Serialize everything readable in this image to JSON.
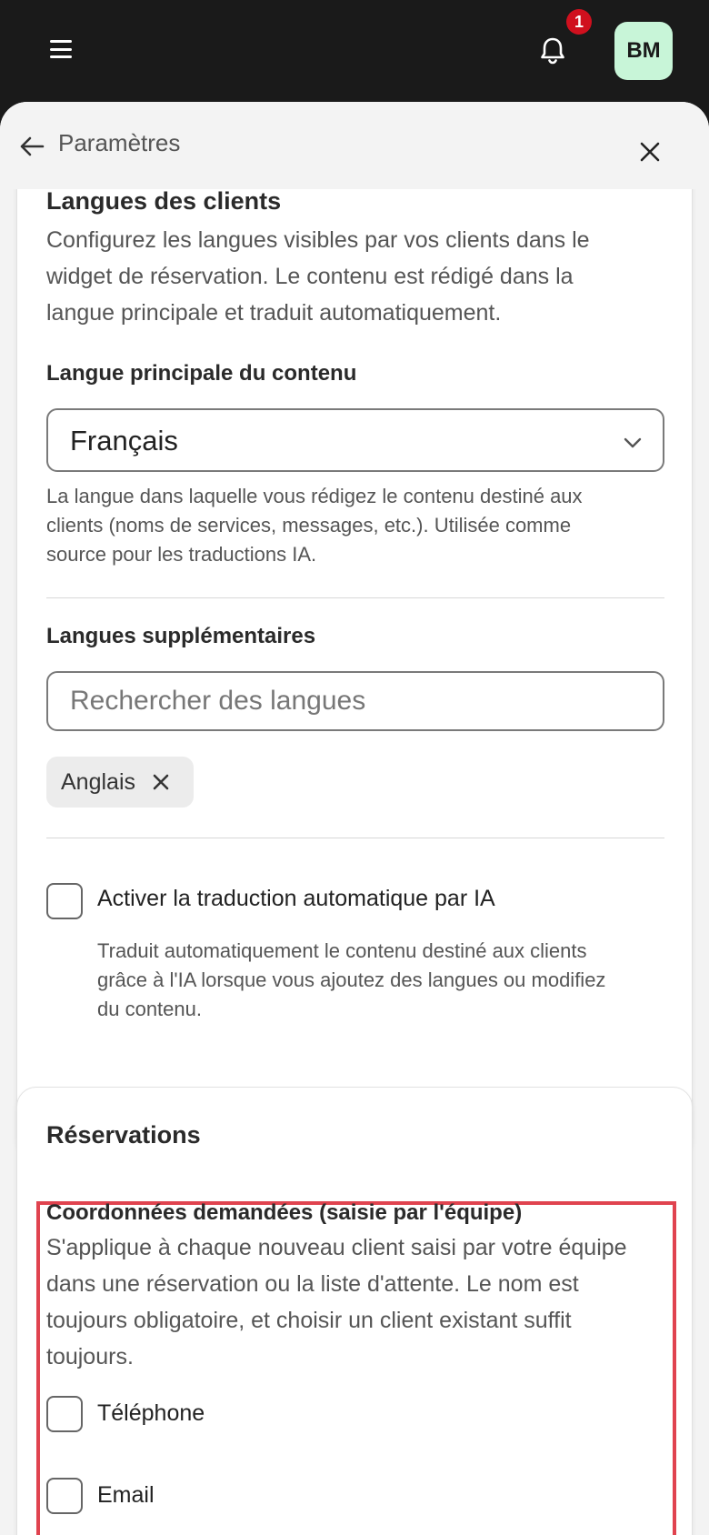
{
  "topbar": {
    "notification_count": "1",
    "avatar_initials": "BM",
    "icons": [
      "menu-icon",
      "bell-icon"
    ]
  },
  "header": {
    "title": "Paramètres",
    "icons": [
      "arrow-left-icon",
      "close-icon"
    ]
  },
  "languages": {
    "title": "Langues des clients",
    "description": [
      "Configurez les langues visibles par vos clients dans le",
      "widget de réservation. Le contenu est rédigé dans la",
      "langue principale et traduit automatiquement."
    ],
    "primary_label": "Langue principale du contenu",
    "primary_value": "Français",
    "primary_help": [
      "La langue dans laquelle vous rédigez le contenu destiné aux",
      "clients (noms de services, messages, etc.). Utilisée comme",
      "source pour les traductions IA."
    ],
    "additional_label": "Langues supplémentaires",
    "search_placeholder": "Rechercher des langues",
    "chips": [
      "Anglais"
    ],
    "auto_translate_label": "Activer la traduction automatique par IA",
    "auto_translate_checked": false,
    "auto_translate_help": [
      "Traduit automatiquement le contenu destiné aux clients",
      "grâce à l'IA lorsque vous ajoutez des langues ou modifiez",
      "du contenu."
    ]
  },
  "reservations": {
    "title": "Réservations",
    "contact_title": "Coordonnées demandées (saisie par l'équipe)",
    "contact_description": [
      "S'applique à chaque nouveau client saisi par votre équipe",
      "dans une réservation ou la liste d'attente. Le nom est",
      "toujours obligatoire, et choisir un client existant suffit",
      "toujours."
    ],
    "phone_label": "Téléphone",
    "phone_checked": false,
    "email_label": "Email",
    "email_checked": false
  },
  "colors": {
    "topbar": "#1a1a1a",
    "badge": "#d0101e",
    "avatar_bg": "#c8f5d8",
    "highlight": "#e0434f"
  }
}
